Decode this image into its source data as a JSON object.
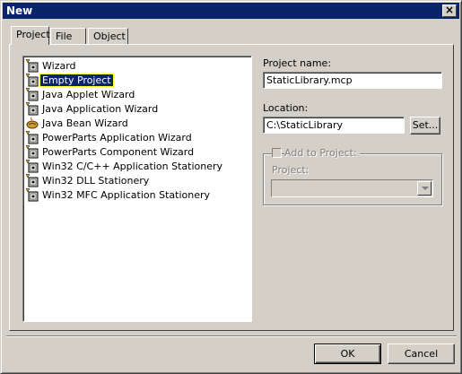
{
  "window": {
    "title": "New",
    "close_glyph": "×"
  },
  "tabs": [
    {
      "label": "Project",
      "active": true
    },
    {
      "label": "File",
      "active": false
    },
    {
      "label": "Object",
      "active": false
    }
  ],
  "project_list": {
    "items": [
      {
        "label": "Wizard",
        "icon": "wizard-icon",
        "selected": false
      },
      {
        "label": "Empty Project",
        "icon": "project-icon",
        "selected": true
      },
      {
        "label": "Java Applet Wizard",
        "icon": "wizard-icon",
        "selected": false
      },
      {
        "label": "Java Application Wizard",
        "icon": "wizard-icon",
        "selected": false
      },
      {
        "label": "Java Bean Wizard",
        "icon": "java-bean-icon",
        "selected": false
      },
      {
        "label": "PowerParts Application Wizard",
        "icon": "wizard-icon",
        "selected": false
      },
      {
        "label": "PowerParts Component Wizard",
        "icon": "wizard-icon",
        "selected": false
      },
      {
        "label": "Win32 C/C++ Application Stationery",
        "icon": "stationery-icon",
        "selected": false
      },
      {
        "label": "Win32 DLL Stationery",
        "icon": "stationery-icon",
        "selected": false
      },
      {
        "label": "Win32 MFC Application Stationery",
        "icon": "stationery-icon",
        "selected": false
      }
    ]
  },
  "form": {
    "project_name_label": "Project name:",
    "project_name_value": "StaticLibrary.mcp",
    "location_label": "Location:",
    "location_value": "C:\\StaticLibrary",
    "set_button": "Set...",
    "add_to_project_label": "Add to Project:",
    "project_label": "Project:",
    "project_select_value": ""
  },
  "buttons": {
    "ok": "OK",
    "cancel": "Cancel"
  },
  "colors": {
    "titlebar": "#0a246a",
    "face": "#d4d0c8",
    "selection": "#0a246a"
  }
}
